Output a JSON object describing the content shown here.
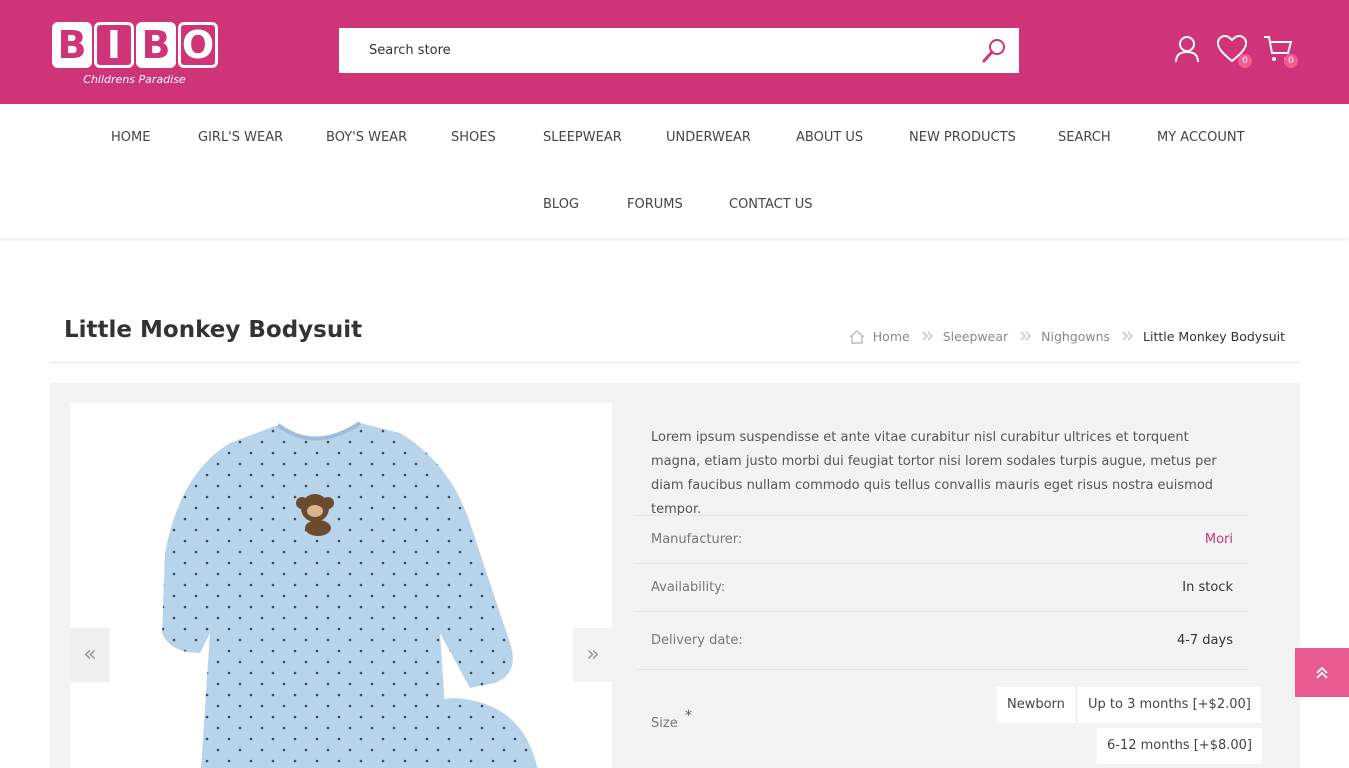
{
  "brand": {
    "letters": [
      "B",
      "I",
      "B",
      "O"
    ],
    "tagline": "Childrens Paradise",
    "primary_color": "#d03478"
  },
  "search": {
    "placeholder": "Search store",
    "icon": "search-icon"
  },
  "header_icons": {
    "account": "user-icon",
    "wishlist": {
      "icon": "heart-icon",
      "count": "0"
    },
    "cart": {
      "icon": "cart-icon",
      "count": "0"
    }
  },
  "nav": {
    "row1": [
      "HOME",
      "GIRL'S WEAR",
      "BOY'S WEAR",
      "SHOES",
      "SLEEPWEAR",
      "UNDERWEAR",
      "ABOUT US",
      "NEW PRODUCTS",
      "SEARCH",
      "MY ACCOUNT"
    ],
    "row2": [
      "BLOG",
      "FORUMS",
      "CONTACT US"
    ]
  },
  "product": {
    "title": "Little Monkey Bodysuit",
    "description": "Lorem ipsum suspendisse et ante vitae curabitur nisl curabitur ultrices et torquent magna, etiam justo morbi dui feugiat tortor nisi lorem sodales turpis augue, metus per diam faucibus nullam commodo quis tellus convallis mauris eget risus nostra euismod tempor.",
    "manufacturer_label": "Manufacturer:",
    "manufacturer": "Mori",
    "availability_label": "Availability:",
    "availability": "In stock",
    "delivery_label": "Delivery date:",
    "delivery": "4-7 days",
    "size_label": "Size",
    "required_mark": "*",
    "sizes": [
      "Newborn",
      "Up to 3 months [+$2.00]",
      "6-12 months [+$8.00]"
    ]
  },
  "breadcrumb": {
    "home": "Home",
    "items": [
      "Sleepwear",
      "Nighgowns"
    ],
    "current": "Little Monkey Bodysuit"
  },
  "gallery": {
    "prev": "«",
    "next": "»"
  },
  "scroll_top": {
    "icon": "double-chevron-up-icon"
  }
}
